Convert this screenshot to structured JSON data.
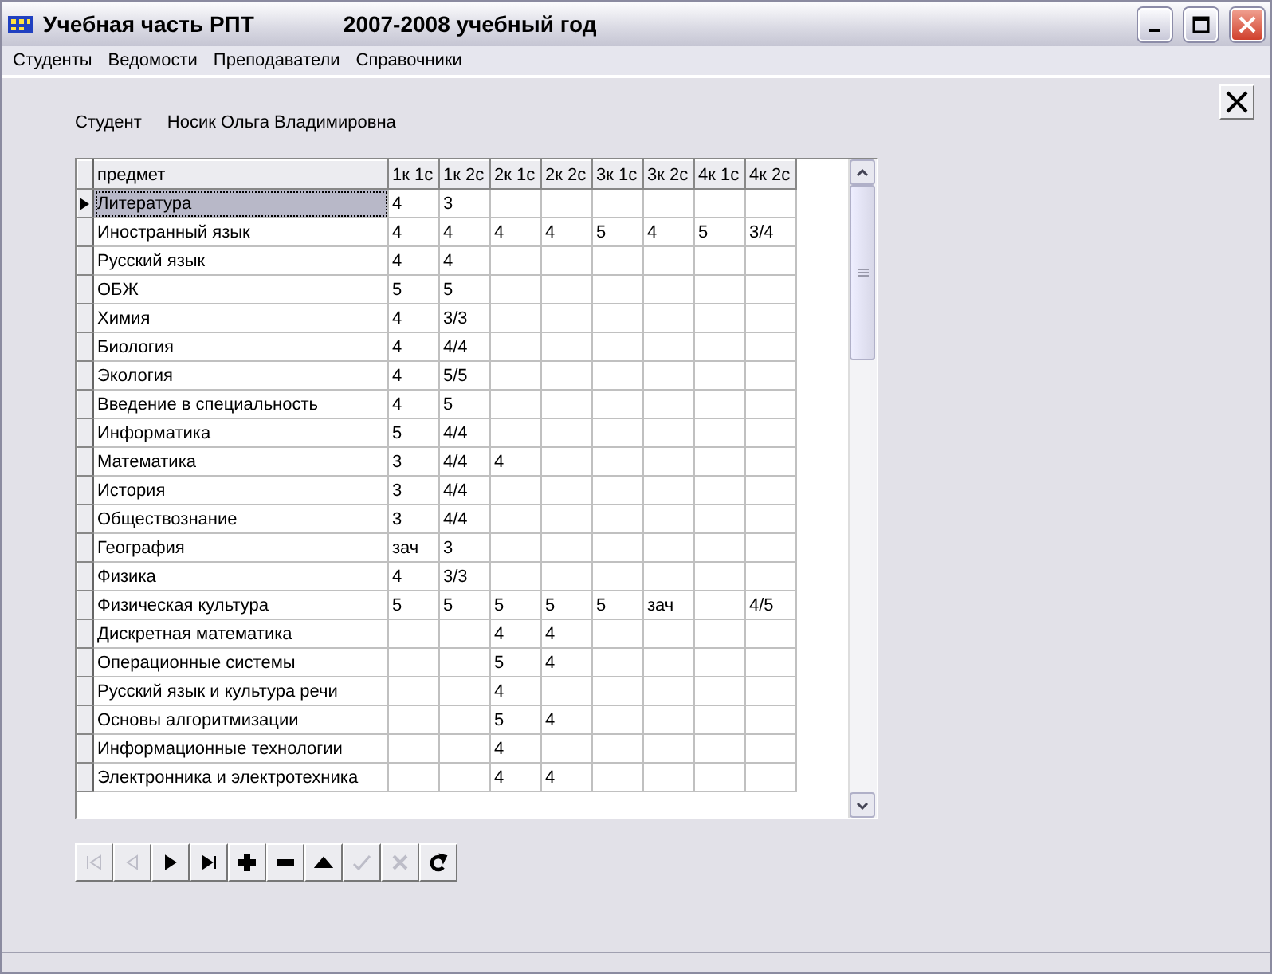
{
  "window": {
    "title": "Учебная часть РПТ",
    "subtitle": "2007-2008 учебный год"
  },
  "menu": [
    "Студенты",
    "Ведомости",
    "Преподаватели",
    "Справочники"
  ],
  "student": {
    "label": "Студент",
    "name": "Носик Ольга Владимировна"
  },
  "table": {
    "columns": [
      "предмет",
      "1к 1с",
      "1к 2с",
      "2к 1с",
      "2к 2с",
      "3к 1с",
      "3к 2с",
      "4к 1с",
      "4к 2с"
    ],
    "rows": [
      {
        "subject": "Литература",
        "grades": {
          "semester_1": "4",
          "semester_2": "3"
        },
        "selected": true
      },
      {
        "subject": "Иностранный язык",
        "grades": {
          "semester_1": "4",
          "semester_2": "4",
          "semester_3": "4",
          "semester_4": "4",
          "semester_5": "5",
          "semester_6": "4",
          "semester_7": "5",
          "semester_8": "3/4"
        },
        "selected": false
      },
      {
        "subject": "Русский язык",
        "grades": {
          "semester_1": "4",
          "semester_2": "4"
        },
        "selected": false
      },
      {
        "subject": "ОБЖ",
        "grades": {
          "semester_1": "5",
          "semester_2": "5"
        },
        "selected": false
      },
      {
        "subject": "Химия",
        "grades": {
          "semester_1": "4",
          "semester_2": "3/3"
        },
        "selected": false
      },
      {
        "subject": "Биология",
        "grades": {
          "semester_1": "4",
          "semester_2": "4/4"
        },
        "selected": false
      },
      {
        "subject": "Экология",
        "grades": {
          "semester_1": "4",
          "semester_2": "5/5"
        },
        "selected": false
      },
      {
        "subject": "Введение в специальность",
        "grades": {
          "semester_1": "4",
          "semester_2": "5"
        },
        "selected": false
      },
      {
        "subject": "Информатика",
        "grades": {
          "semester_1": "5",
          "semester_2": "4/4"
        },
        "selected": false
      },
      {
        "subject": "Математика",
        "grades": {
          "semester_1": "3",
          "semester_2": "4/4",
          "semester_3": "4"
        },
        "selected": false
      },
      {
        "subject": "История",
        "grades": {
          "semester_1": "3",
          "semester_2": "4/4"
        },
        "selected": false
      },
      {
        "subject": "Обществознание",
        "grades": {
          "semester_1": "3",
          "semester_2": "4/4"
        },
        "selected": false
      },
      {
        "subject": "География",
        "grades": {
          "semester_1": "зач",
          "semester_2": "3"
        },
        "selected": false
      },
      {
        "subject": "Физика",
        "grades": {
          "semester_1": "4",
          "semester_2": "3/3"
        },
        "selected": false
      },
      {
        "subject": "Физическая культура",
        "grades": {
          "semester_1": "5",
          "semester_2": "5",
          "semester_3": "5",
          "semester_4": "5",
          "semester_5": "5",
          "semester_6": "зач",
          "semester_8": "4/5"
        },
        "selected": false
      },
      {
        "subject": "Дискретная математика",
        "grades": {
          "semester_3": "4",
          "semester_4": "4"
        },
        "selected": false
      },
      {
        "subject": "Операционные системы",
        "grades": {
          "semester_3": "5",
          "semester_4": "4"
        },
        "selected": false
      },
      {
        "subject": "Русский язык и культура речи",
        "grades": {
          "semester_3": "4"
        },
        "selected": false
      },
      {
        "subject": "Основы алгоритмизации",
        "grades": {
          "semester_3": "5",
          "semester_4": "4"
        },
        "selected": false
      },
      {
        "subject": "Информационные технологии",
        "grades": {
          "semester_3": "4"
        },
        "selected": false
      },
      {
        "subject": "Электронника и электротехника",
        "grades": {
          "semester_3": "4",
          "semester_4": "4"
        },
        "selected": false
      }
    ]
  },
  "navigator": [
    {
      "kind": "first",
      "disabled": true
    },
    {
      "kind": "prior",
      "disabled": true
    },
    {
      "kind": "next",
      "disabled": false
    },
    {
      "kind": "last",
      "disabled": false
    },
    {
      "kind": "insert",
      "disabled": false
    },
    {
      "kind": "delete",
      "disabled": false
    },
    {
      "kind": "edit",
      "disabled": false
    },
    {
      "kind": "post",
      "disabled": true
    },
    {
      "kind": "cancel",
      "disabled": true
    },
    {
      "kind": "refresh",
      "disabled": false
    }
  ]
}
